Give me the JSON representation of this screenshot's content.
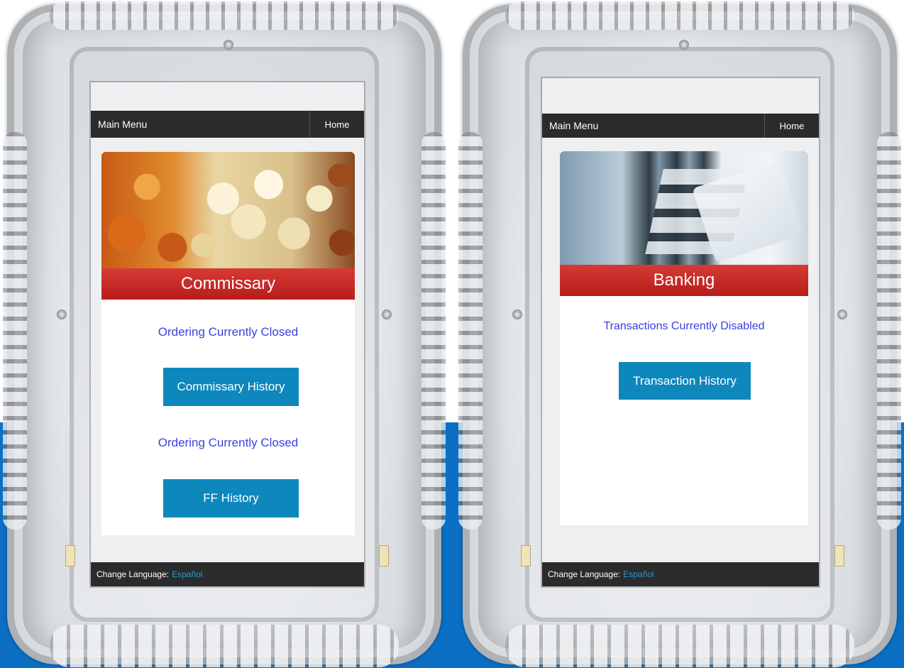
{
  "left_kiosk": {
    "nav": {
      "menu_label": "Main Menu",
      "home_label": "Home"
    },
    "section_title": "Commissary",
    "status_1": "Ordering Currently Closed",
    "button_1": "Commissary History",
    "status_2": "Ordering Currently Closed",
    "button_2": "FF History",
    "footer": {
      "change_language_label": "Change Language:",
      "language_link": "Español"
    }
  },
  "right_kiosk": {
    "nav": {
      "menu_label": "Main Menu",
      "home_label": "Home"
    },
    "section_title": "Banking",
    "status_1": "Transactions Currently Disabled",
    "button_1": "Transaction History",
    "footer": {
      "change_language_label": "Change Language:",
      "language_link": "Español"
    }
  },
  "colors": {
    "background_blue": "#0b6fc4",
    "nav_bar": "#2b2b2b",
    "banner_red": "#c62a25",
    "button_blue": "#0e87bd",
    "status_text": "#3a3fe0",
    "link_blue": "#1ea0d6"
  }
}
